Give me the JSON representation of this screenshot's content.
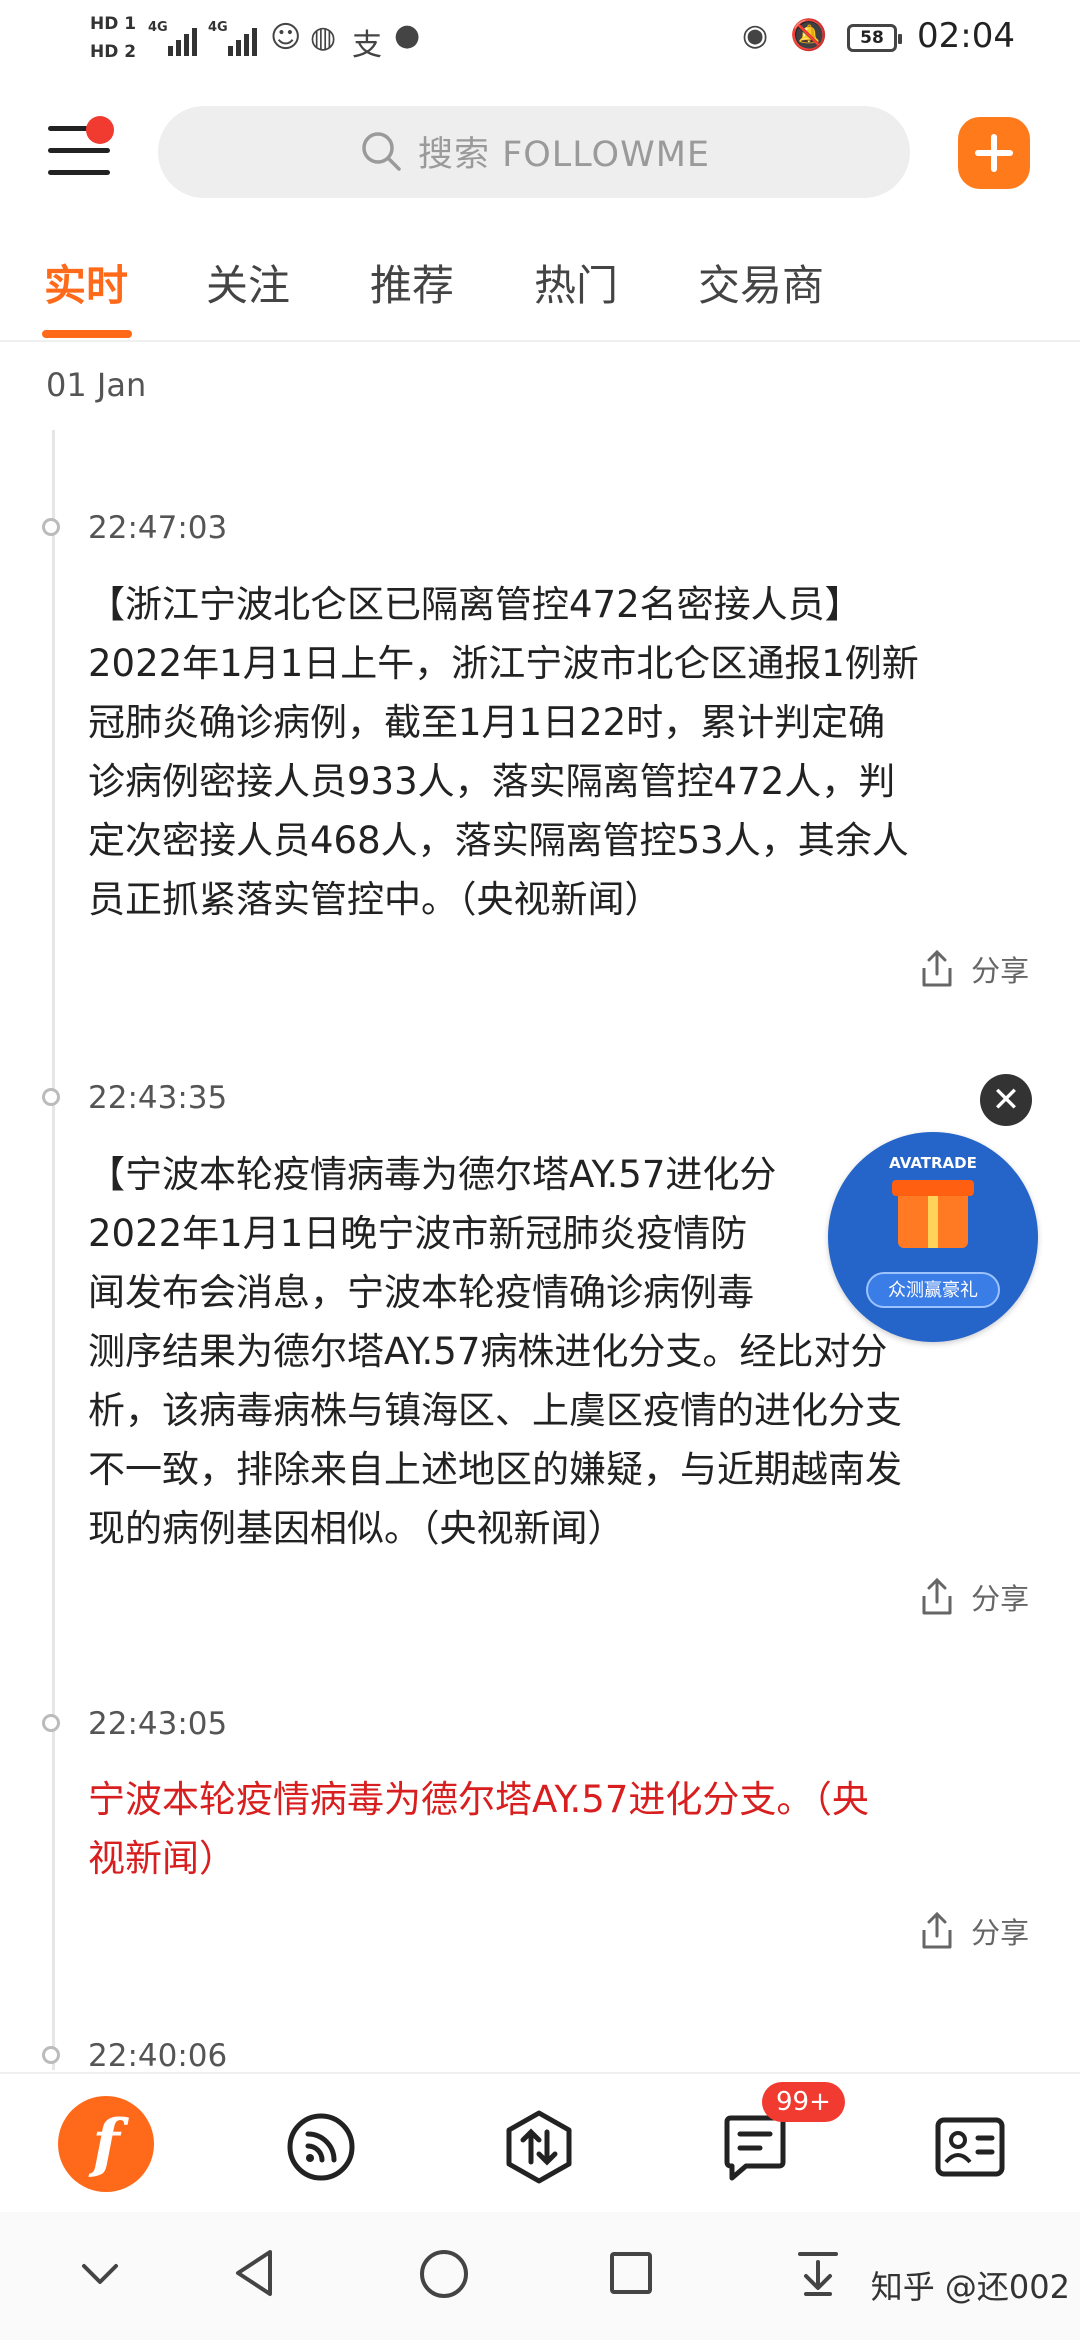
{
  "status_bar": {
    "hd1": "HD 1",
    "hd2": "HD 2",
    "net1": "4G",
    "net2": "4G",
    "battery": "58",
    "time": "02:04",
    "icons": [
      "emoji-icon",
      "browser-icon",
      "alipay-icon",
      "chat-icon",
      "eye-icon",
      "mute-icon"
    ]
  },
  "header": {
    "search_placeholder": "搜索 FOLLOWME",
    "menu_badge_color": "#f23b30",
    "accent": "#ff6a1a"
  },
  "tabs": [
    {
      "label": "实时",
      "active": true
    },
    {
      "label": "关注"
    },
    {
      "label": "推荐"
    },
    {
      "label": "热门"
    },
    {
      "label": "交易商"
    }
  ],
  "date": "01 Jan",
  "news": [
    {
      "time": "22:47:03",
      "lines": [
        "【浙江宁波北仑区已隔离管控472名密接人员】",
        "2022年1月1日上午，浙江宁波市北仑区通报1例新",
        "冠肺炎确诊病例，截至1月1日22时，累计判定确",
        "诊病例密接人员933人，落实隔离管控472人，判",
        "定次密接人员468人，落实隔离管控53人，其余人",
        "员正抓紧落实管控中。（央视新闻）"
      ],
      "share": "分享"
    },
    {
      "time": "22:43:35",
      "lines": [
        "【宁波本轮疫情病毒为德尔塔AY.57进化分",
        "2022年1月1日晚宁波市新冠肺炎疫情防",
        "闻发布会消息，宁波本轮疫情确诊病例毒",
        "测序结果为德尔塔AY.57病株进化分支。经比对分",
        "析，该病毒病株与镇海区、上虞区疫情的进化分支",
        "不一致，排除来自上述地区的嫌疑，与近期越南发",
        "现的病例基因相似。（央视新闻）"
      ],
      "share": "分享"
    },
    {
      "time": "22:43:05",
      "lines": [
        "宁波本轮疫情病毒为德尔塔AY.57进化分支。（央",
        "视新闻）"
      ],
      "share": "分享",
      "highlight_color": "#d81e1e"
    },
    {
      "time": "22:40:06"
    }
  ],
  "ad": {
    "brand": "AVATRADE",
    "label": "众测赢豪礼",
    "close": "✕"
  },
  "bottom_nav": {
    "items": [
      "home-icon",
      "feed-icon",
      "trade-icon",
      "messages-icon",
      "profile-card-icon"
    ],
    "badge": "99+"
  },
  "watermark": "知乎 @还002"
}
